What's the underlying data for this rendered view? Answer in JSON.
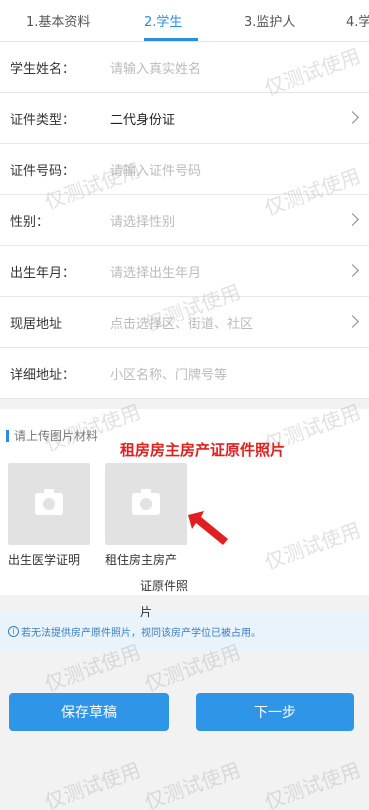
{
  "tabs": [
    {
      "label": "1.基本资料"
    },
    {
      "label": "2.学生"
    },
    {
      "label": "3.监护人"
    },
    {
      "label": "4.学"
    }
  ],
  "form": {
    "student_name": {
      "label": "学生姓名：",
      "placeholder": "请输入真实姓名"
    },
    "id_type": {
      "label": "证件类型：",
      "value": "二代身份证"
    },
    "id_number": {
      "label": "证件号码：",
      "placeholder": "请输入证件号码"
    },
    "gender": {
      "label": "性别：",
      "placeholder": "请选择性别"
    },
    "birth": {
      "label": "出生年月：",
      "placeholder": "请选择出生年月"
    },
    "current_address": {
      "label": "现居地址",
      "placeholder": "点击选择区、街道、社区"
    },
    "detail_address": {
      "label": "详细地址：",
      "placeholder": "小区名称、门牌号等"
    }
  },
  "upload": {
    "title": "请上传图片材料",
    "annotation": "租房房主房产证原件照片",
    "photos": [
      {
        "caption": "出生医学证明"
      },
      {
        "caption_line1": "租住房主房产",
        "caption_line2": "证原件照片"
      }
    ]
  },
  "notice": {
    "icon": "info-icon",
    "text": "若无法提供房产原件照片，视同该房产学位已被占用。"
  },
  "actions": {
    "save_label": "保存草稿",
    "next_label": "下一步"
  },
  "watermark": "仅测试使用",
  "colors": {
    "accent": "#2b8ce0",
    "annotation": "#e02020",
    "notice_bg": "#e9f3fb"
  }
}
